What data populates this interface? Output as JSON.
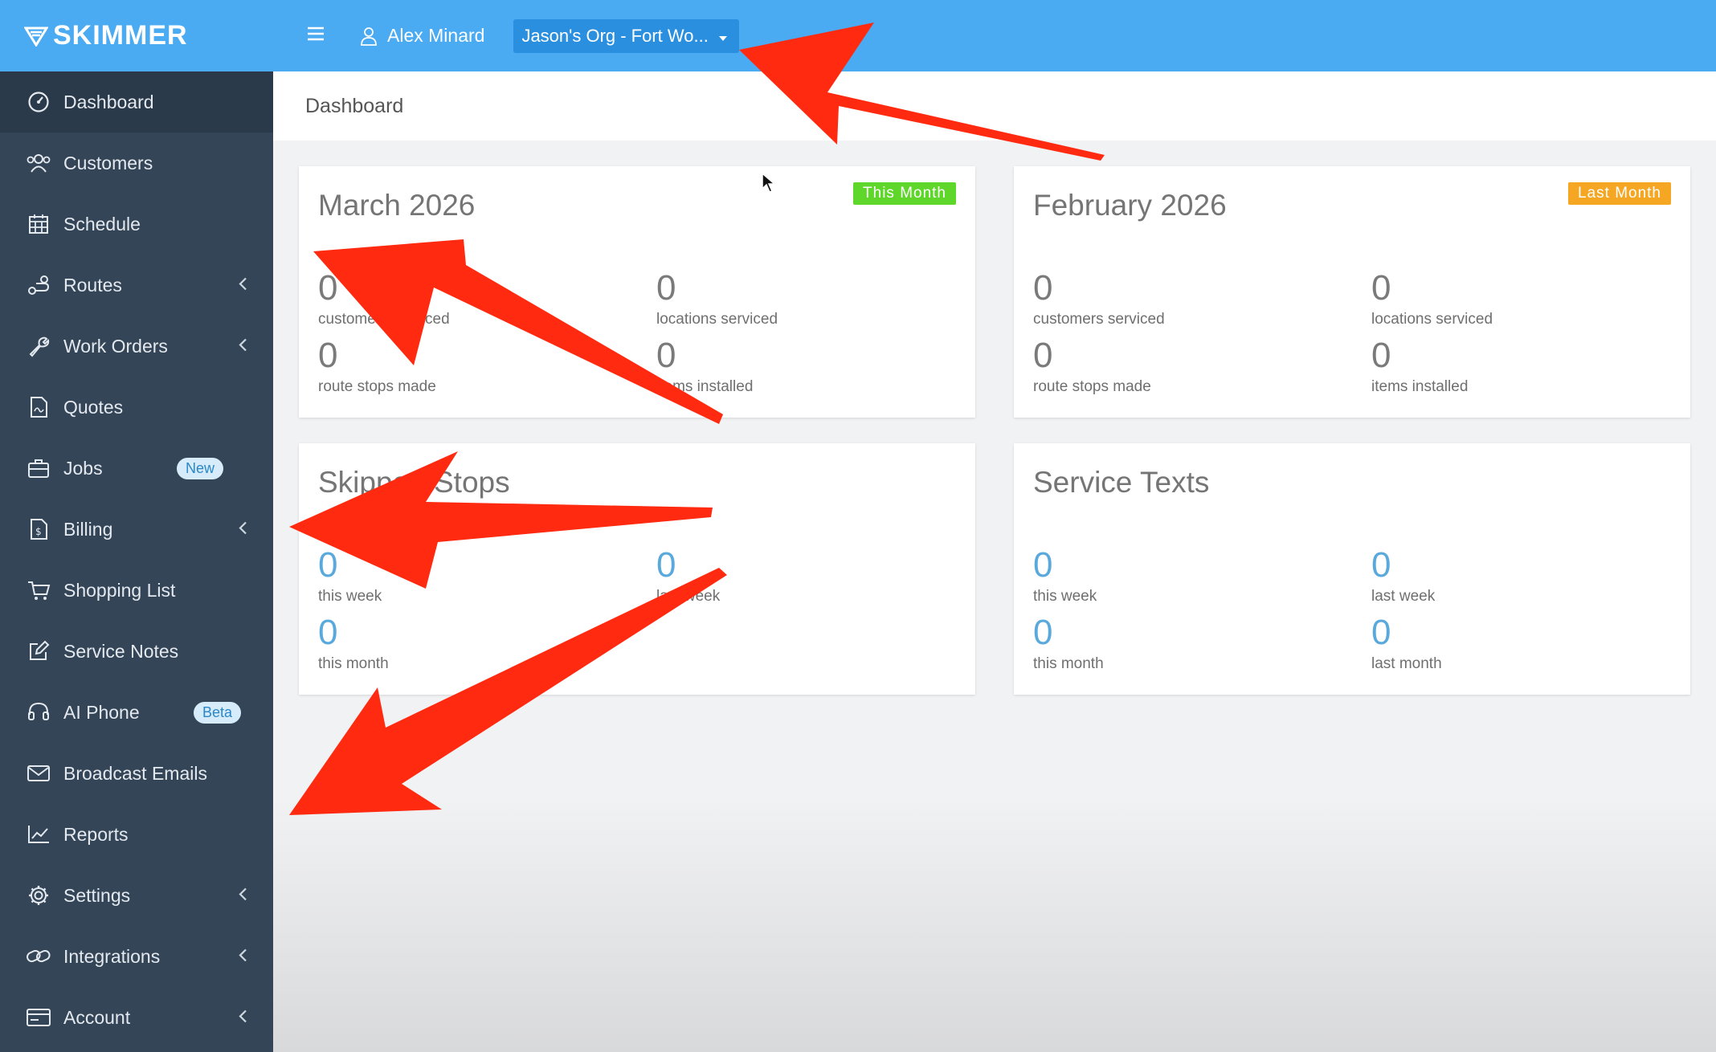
{
  "brand": {
    "name": "SKIMMER"
  },
  "sidebar": {
    "items": [
      {
        "label": "Dashboard",
        "icon": "dashboard-icon",
        "active": true
      },
      {
        "label": "Customers",
        "icon": "users-icon"
      },
      {
        "label": "Schedule",
        "icon": "calendar-icon"
      },
      {
        "label": "Routes",
        "icon": "route-icon",
        "expandable": true
      },
      {
        "label": "Work Orders",
        "icon": "wrench-icon",
        "expandable": true
      },
      {
        "label": "Quotes",
        "icon": "document-icon"
      },
      {
        "label": "Jobs",
        "icon": "briefcase-icon",
        "badge": "New"
      },
      {
        "label": "Billing",
        "icon": "invoice-icon",
        "expandable": true
      },
      {
        "label": "Shopping List",
        "icon": "cart-icon"
      },
      {
        "label": "Service Notes",
        "icon": "edit-icon"
      },
      {
        "label": "AI Phone",
        "icon": "headset-icon",
        "badge": "Beta"
      },
      {
        "label": "Broadcast Emails",
        "icon": "envelope-icon"
      },
      {
        "label": "Reports",
        "icon": "chart-line-icon"
      },
      {
        "label": "Settings",
        "icon": "gear-icon",
        "expandable": true
      },
      {
        "label": "Integrations",
        "icon": "link-icon",
        "expandable": true
      },
      {
        "label": "Account",
        "icon": "card-icon",
        "expandable": true
      }
    ]
  },
  "topbar": {
    "user": "Alex Minard",
    "org": "Jason's Org - Fort Wo..."
  },
  "breadcrumb": "Dashboard",
  "cards": {
    "current": {
      "title": "March 2026",
      "tag": "This Month",
      "stats": [
        {
          "value": "0",
          "label": "customers serviced"
        },
        {
          "value": "0",
          "label": "locations serviced"
        },
        {
          "value": "0",
          "label": "route stops made"
        },
        {
          "value": "0",
          "label": "items installed"
        }
      ]
    },
    "previous": {
      "title": "February 2026",
      "tag": "Last Month",
      "stats": [
        {
          "value": "0",
          "label": "customers serviced"
        },
        {
          "value": "0",
          "label": "locations serviced"
        },
        {
          "value": "0",
          "label": "route stops made"
        },
        {
          "value": "0",
          "label": "items installed"
        }
      ]
    },
    "skipped": {
      "title": "Skipped Stops",
      "stats": [
        {
          "value": "0",
          "label": "this week"
        },
        {
          "value": "0",
          "label": "last week"
        },
        {
          "value": "0",
          "label": "this month"
        }
      ]
    },
    "texts": {
      "title": "Service Texts",
      "stats": [
        {
          "value": "0",
          "label": "this week"
        },
        {
          "value": "0",
          "label": "last week"
        },
        {
          "value": "0",
          "label": "this month"
        },
        {
          "value": "0",
          "label": "last month"
        }
      ]
    }
  },
  "colors": {
    "sidebar": "#344557",
    "topbar": "#4aaaf2",
    "annotation_arrow": "#ff2a10",
    "tag_green": "#5ed62a",
    "tag_orange": "#f5a623"
  }
}
